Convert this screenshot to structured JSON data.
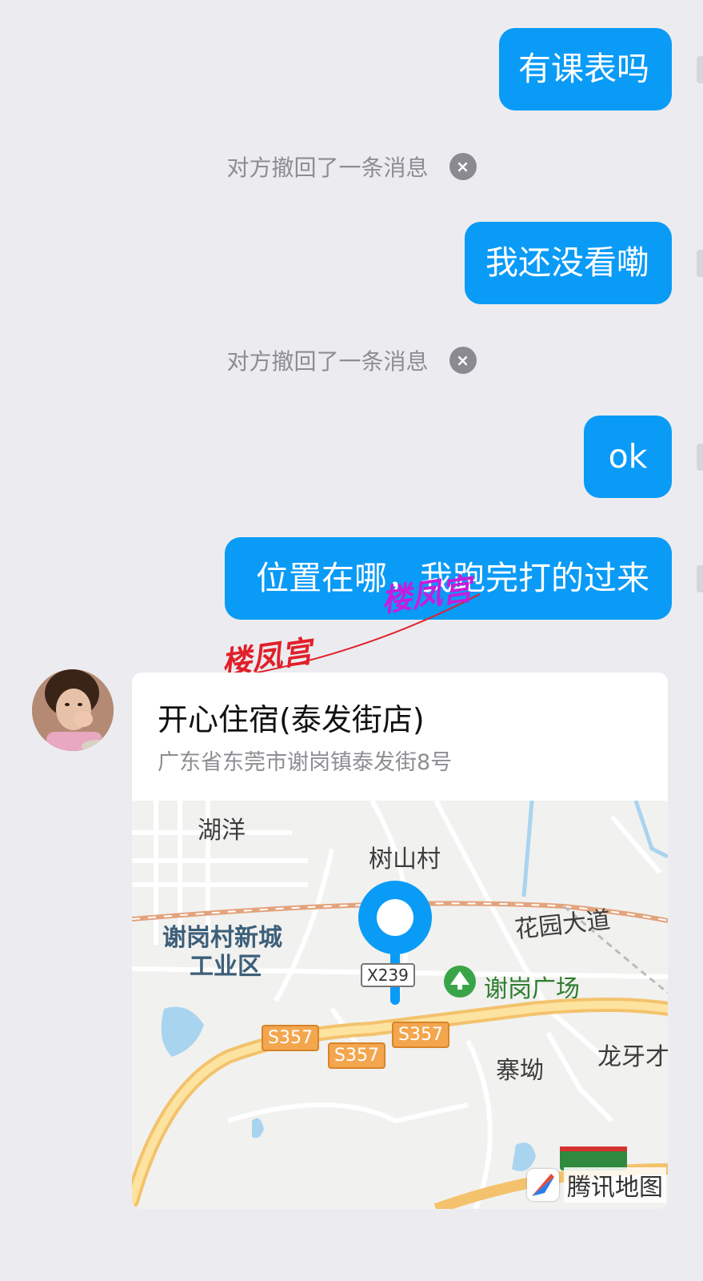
{
  "messages": [
    {
      "text": "有课表吗"
    },
    {
      "text": "我还没看嘞"
    },
    {
      "text": "ok"
    },
    {
      "text": "位置在哪，我跑完打的过来"
    }
  ],
  "system_notice": "对方撤回了一条消息",
  "close_icon": "×",
  "watermark": "楼凤宫",
  "location": {
    "name": "开心住宿(泰发街店)",
    "address": "广东省东莞市谢岗镇泰发街8号"
  },
  "map": {
    "labels": {
      "huyang": "湖洋",
      "shushancun": "树山村",
      "xiegang_industry_line1": "谢岗村新城",
      "xiegang_industry_line2": "工业区",
      "huayuan": "花园大道",
      "square": "谢岗广场",
      "zhaiao": "寨坳",
      "longya": "龙牙才"
    },
    "roads": {
      "x": "X239",
      "s1": "S357",
      "s2": "S357",
      "s3": "S357"
    },
    "brand": "腾讯地图",
    "pin_color": "#0a9bf7"
  },
  "colors": {
    "accent": "#0a9bf7",
    "background": "#ececf0"
  }
}
